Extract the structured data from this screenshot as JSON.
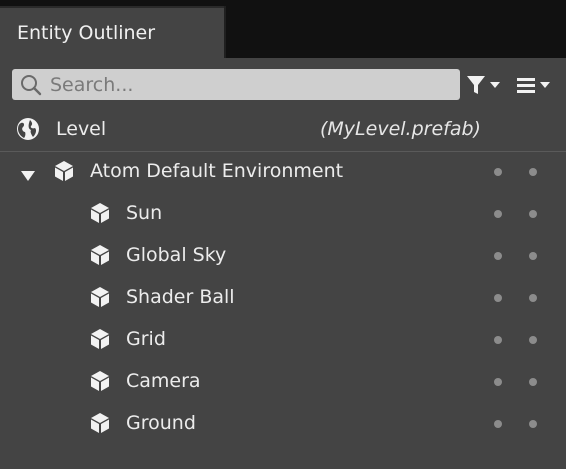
{
  "panel": {
    "tab_title": "Entity Outliner"
  },
  "toolbar": {
    "search_placeholder": "Search...",
    "filter_icon": "filter-icon",
    "display_options_icon": "list-icon"
  },
  "level": {
    "label": "Level",
    "prefab": "(MyLevel.prefab)",
    "icon": "globe-icon"
  },
  "entities": [
    {
      "name": "Atom Default Environment",
      "depth": 0,
      "expanded": true
    },
    {
      "name": "Sun",
      "depth": 1
    },
    {
      "name": "Global Sky",
      "depth": 1
    },
    {
      "name": "Shader Ball",
      "depth": 1
    },
    {
      "name": "Grid",
      "depth": 1
    },
    {
      "name": "Camera",
      "depth": 1
    },
    {
      "name": "Ground",
      "depth": 1
    }
  ],
  "colors": {
    "panel_bg": "#444444",
    "tab_strip_bg": "#111111",
    "search_bg": "#cfcfcf",
    "text": "#ececec",
    "dot": "#8c8c8c"
  }
}
